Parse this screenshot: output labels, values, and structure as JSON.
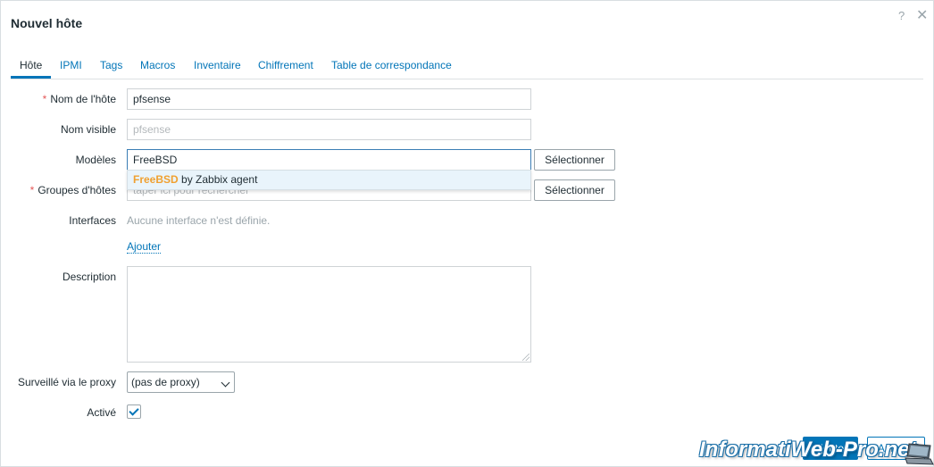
{
  "dialog": {
    "title": "Nouvel hôte",
    "help_icon": "?",
    "close_icon": "✕"
  },
  "tabs": [
    {
      "label": "Hôte",
      "active": true
    },
    {
      "label": "IPMI"
    },
    {
      "label": "Tags"
    },
    {
      "label": "Macros"
    },
    {
      "label": "Inventaire"
    },
    {
      "label": "Chiffrement"
    },
    {
      "label": "Table de correspondance"
    }
  ],
  "form": {
    "host_name": {
      "label": "Nom de l'hôte",
      "required": "*",
      "value": "pfsense"
    },
    "visible_name": {
      "label": "Nom visible",
      "placeholder": "pfsense"
    },
    "templates": {
      "label": "Modèles",
      "value": "FreeBSD",
      "select_label": "Sélectionner",
      "suggestion_match": "FreeBSD",
      "suggestion_rest": " by Zabbix agent"
    },
    "host_groups": {
      "label": "Groupes d'hôtes",
      "required": "*",
      "placeholder": "taper ici pour rechercher",
      "select_label": "Sélectionner"
    },
    "interfaces": {
      "label": "Interfaces",
      "text": "Aucune interface n'est définie.",
      "add_link": "Ajouter"
    },
    "description": {
      "label": "Description",
      "value": ""
    },
    "proxy": {
      "label": "Surveillé via le proxy",
      "value": "(pas de proxy)"
    },
    "enabled": {
      "label": "Activé",
      "checked": true
    }
  },
  "footer": {
    "add_button": "Ajouter",
    "cancel_button": "Annuler"
  },
  "watermark": "InformatiWeb-Pro.net",
  "colors": {
    "accent": "#0275b8",
    "required": "#e45959",
    "suggestion_highlight": "#f0a030",
    "suggestion_bg": "#e9f4fb"
  }
}
